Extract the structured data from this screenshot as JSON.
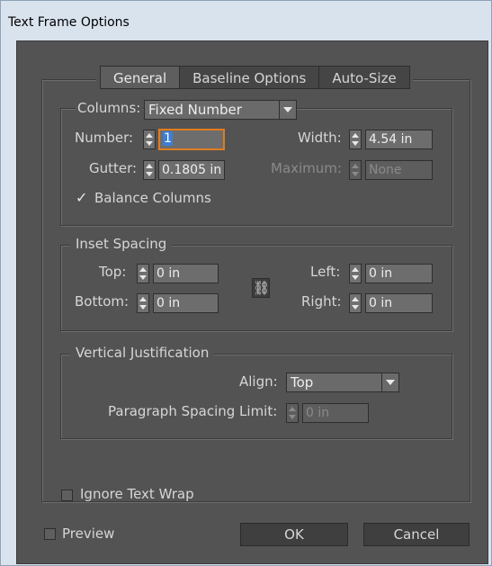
{
  "window": {
    "title": "Text Frame Options"
  },
  "tabs": [
    {
      "label": "General",
      "active": true
    },
    {
      "label": "Baseline Options",
      "active": false
    },
    {
      "label": "Auto-Size",
      "active": false
    }
  ],
  "columns": {
    "label": "Columns:",
    "mode": "Fixed Number",
    "number_label": "Number:",
    "number_value": "1",
    "width_label": "Width:",
    "width_value": "4.54 in",
    "gutter_label": "Gutter:",
    "gutter_value": "0.1805 in",
    "maximum_label": "Maximum:",
    "maximum_value": "None",
    "balance_label": "Balance Columns",
    "balance_checked": true
  },
  "inset": {
    "title": "Inset Spacing",
    "top_label": "Top:",
    "top_value": "0 in",
    "bottom_label": "Bottom:",
    "bottom_value": "0 in",
    "left_label": "Left:",
    "left_value": "0 in",
    "right_label": "Right:",
    "right_value": "0 in"
  },
  "vertical": {
    "title": "Vertical Justification",
    "align_label": "Align:",
    "align_value": "Top",
    "spacing_label": "Paragraph Spacing Limit:",
    "spacing_value": "0 in"
  },
  "ignore_wrap": {
    "label": "Ignore Text Wrap",
    "checked": false
  },
  "preview": {
    "label": "Preview",
    "checked": false
  },
  "buttons": {
    "ok": "OK",
    "cancel": "Cancel"
  },
  "colors": {
    "panel": "#535353",
    "focus": "#e07c1f",
    "selection": "#3c7fd6"
  }
}
